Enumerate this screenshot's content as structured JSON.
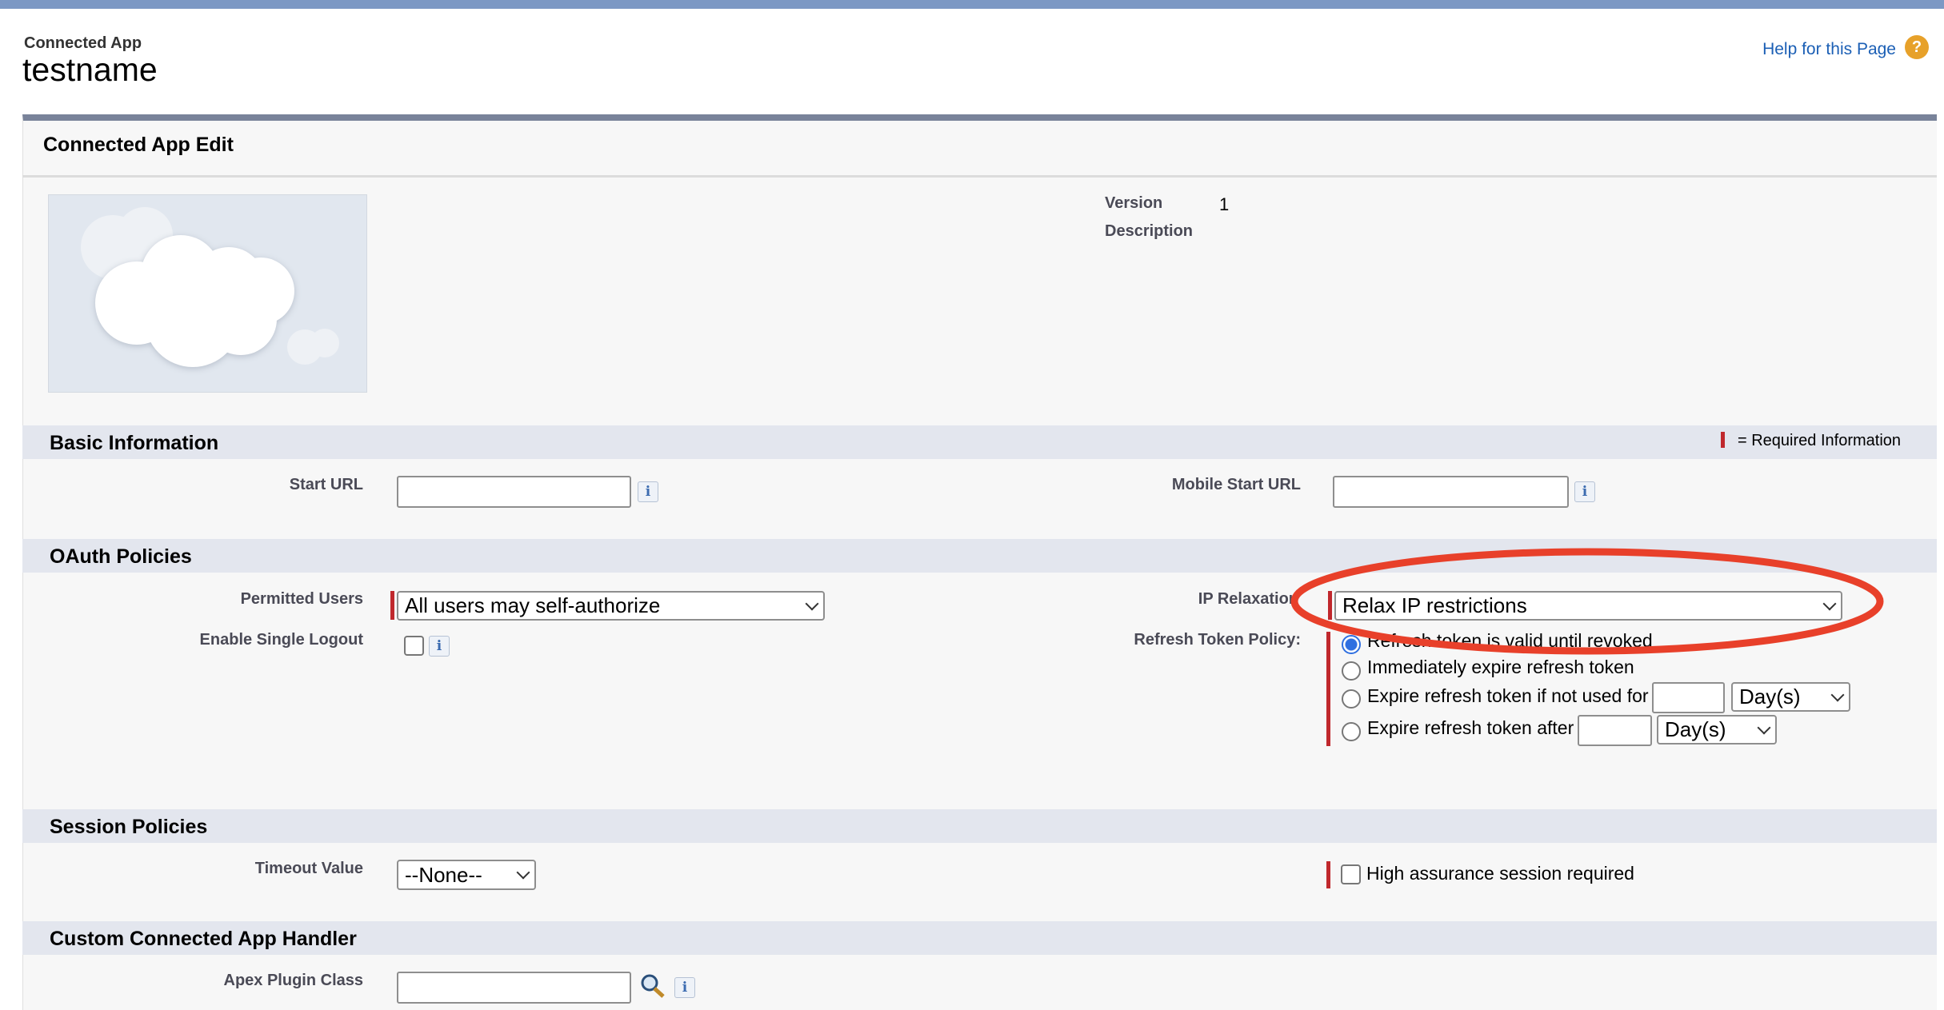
{
  "header": {
    "object_type": "Connected App",
    "title": "testname",
    "help_link": "Help for this Page"
  },
  "panel": {
    "title": "Connected App Edit",
    "version_label": "Version",
    "version_value": "1",
    "description_label": "Description"
  },
  "basic": {
    "title": "Basic Information",
    "required_legend": "= Required Information",
    "start_url_label": "Start URL",
    "start_url_value": "",
    "mobile_start_url_label": "Mobile Start URL",
    "mobile_start_url_value": ""
  },
  "oauth": {
    "title": "OAuth Policies",
    "permitted_users_label": "Permitted Users",
    "permitted_users_value": "All users may self-authorize",
    "single_logout_label": "Enable Single Logout",
    "single_logout_checked": false,
    "ip_relaxation_label": "IP Relaxation",
    "ip_relaxation_value": "Relax IP restrictions",
    "refresh_label": "Refresh Token Policy:",
    "refresh_options": [
      "Refresh token is valid until revoked",
      "Immediately expire refresh token",
      "Expire refresh token if not used for",
      "Expire refresh token after"
    ],
    "refresh_selected": 0,
    "unit_not_used": "Day(s)",
    "unit_after": "Day(s)"
  },
  "session": {
    "title": "Session Policies",
    "timeout_label": "Timeout Value",
    "timeout_value": "--None--",
    "high_assurance_label": "High assurance session required",
    "high_assurance_checked": false
  },
  "handler": {
    "title": "Custom Connected App Handler",
    "apex_label": "Apex Plugin Class",
    "apex_value": ""
  },
  "annotation": {
    "color": "#e8402a"
  },
  "icons": {
    "info": "i",
    "help": "?"
  }
}
